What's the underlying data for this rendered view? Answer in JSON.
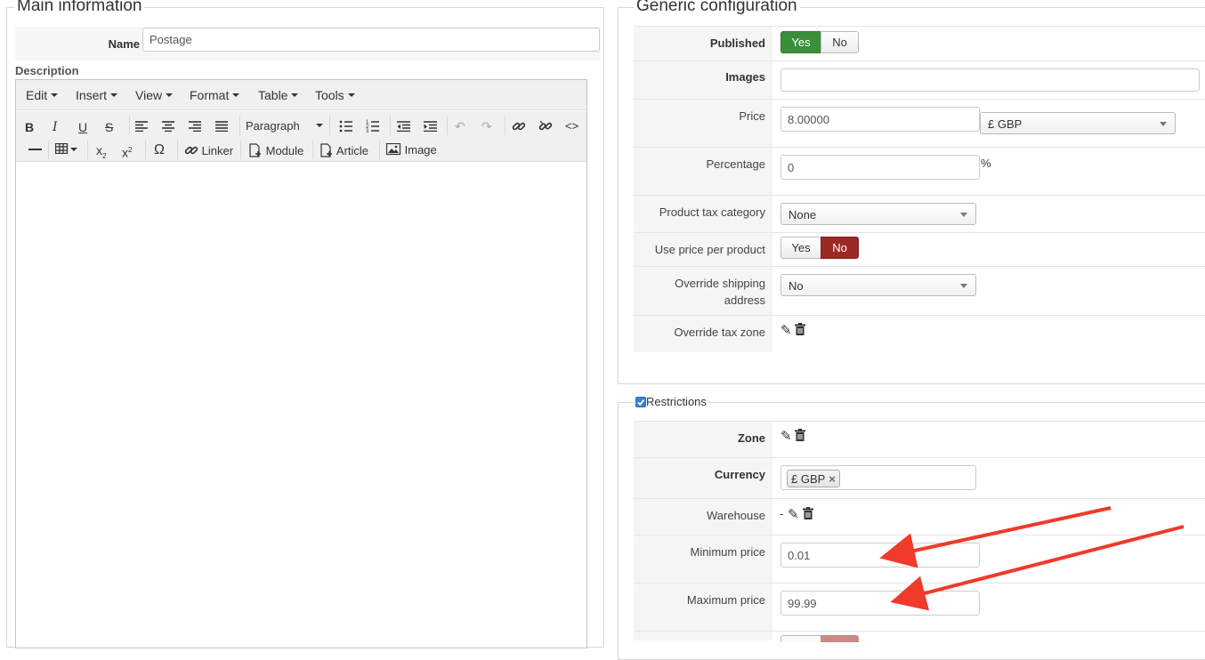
{
  "main_info": {
    "legend": "Main information",
    "name_label": "Name",
    "name_value": "Postage",
    "description_label": "Description",
    "editor": {
      "menu": [
        "Edit",
        "Insert",
        "View",
        "Format",
        "Table",
        "Tools"
      ],
      "block_format": "Paragraph",
      "linker_label": "Linker",
      "module_label": "Module",
      "article_label": "Article",
      "image_label": "Image"
    }
  },
  "generic": {
    "legend": "Generic configuration",
    "published_label": "Published",
    "published_yes": "Yes",
    "published_no": "No",
    "images_label": "Images",
    "price_label": "Price",
    "price_value": "8.00000",
    "price_currency": "£ GBP",
    "percentage_label": "Percentage",
    "percentage_value": "0",
    "percentage_unit": "%",
    "tax_category_label": "Product tax category",
    "tax_category_value": "None",
    "price_per_product_label": "Use price per product",
    "price_per_product_yes": "Yes",
    "price_per_product_no": "No",
    "override_shipping_label_1": "Override shipping",
    "override_shipping_label_2": "address",
    "override_shipping_value": "No",
    "override_tax_zone_label": "Override tax zone"
  },
  "restrictions": {
    "legend": "Restrictions",
    "zone_label": "Zone",
    "currency_label": "Currency",
    "currency_tag": "£ GBP",
    "currency_tag_remove": "×",
    "warehouse_label": "Warehouse",
    "warehouse_value": "-",
    "min_price_label": "Minimum price",
    "min_price_value": "0.01",
    "max_price_label": "Maximum price",
    "max_price_value": "99.99"
  },
  "colors": {
    "yes_active": "#3a8f3a",
    "no_active": "#9b2a25",
    "annotation_arrow": "#f03a2a"
  }
}
